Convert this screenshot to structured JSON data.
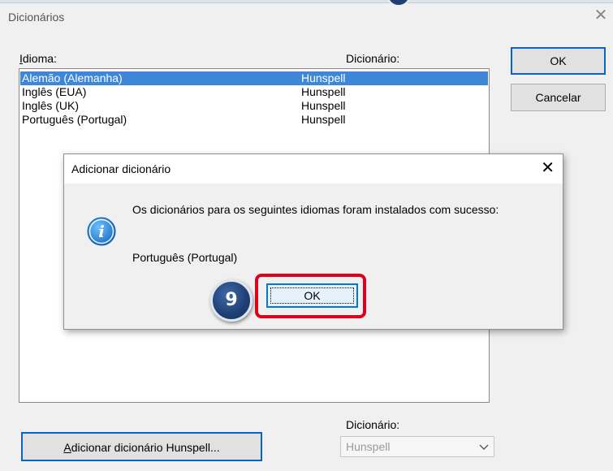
{
  "window": {
    "title": "Dicionários",
    "close_glyph": "✕"
  },
  "columns": {
    "language_label_accel": "I",
    "language_label_rest": "dioma:",
    "dictionary_label": "Dicionário:"
  },
  "languages": [
    {
      "name": "Alemão (Alemanha)",
      "dictionary": "Hunspell",
      "selected": true
    },
    {
      "name": "Inglês (EUA)",
      "dictionary": "Hunspell",
      "selected": false
    },
    {
      "name": "Inglês (UK)",
      "dictionary": "Hunspell",
      "selected": false
    },
    {
      "name": "Português (Portugal)",
      "dictionary": "Hunspell",
      "selected": false
    }
  ],
  "buttons": {
    "ok": "OK",
    "cancel": "Cancelar",
    "add_hunspell_accel": "A",
    "add_hunspell_rest": "dicionar dicionário Hunspell..."
  },
  "bottom": {
    "dictionary_label": "Dicionário:",
    "dictionary_select_value": "Hunspell"
  },
  "modal": {
    "title": "Adicionar dicionário",
    "close_glyph": "✕",
    "message": "Os dicionários para os seguintes idiomas foram instalados com sucesso:",
    "installed_language": "Português (Portugal)",
    "ok": "OK",
    "icon": "info-icon"
  },
  "annotation": {
    "step_number": "9",
    "highlight_color": "#e0001b",
    "badge_color": "#1f3f73"
  },
  "colors": {
    "selection": "#3d86d8",
    "focus_border": "#0078d7"
  }
}
